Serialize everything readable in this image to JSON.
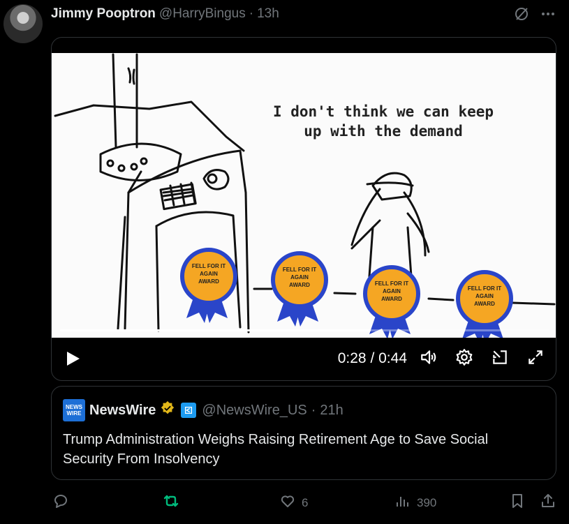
{
  "tweet": {
    "author_name": "Jimmy Pooptron",
    "author_handle": "@HarryBingus",
    "separator": "·",
    "time": "13h"
  },
  "media": {
    "caption_line1": "I don't think we can keep",
    "caption_line2": "up with the demand",
    "award_text": [
      "FELL FOR IT",
      "AGAIN",
      "AWARD"
    ],
    "current_time": "0:28",
    "time_sep": "/",
    "duration": "0:44",
    "progress": 0.636
  },
  "quote": {
    "logo_line1": "NEWS",
    "logo_line2": "WIRE",
    "name": "NewsWire",
    "handle": "@NewsWire_US",
    "separator": "·",
    "time": "21h",
    "text": "Trump Administration Weighs Raising Retirement Age to Save Social Security From Insolvency"
  },
  "actions": {
    "likes": "6",
    "views": "390"
  },
  "colors": {
    "retweet_active": "#00ba7c",
    "muted": "#71767b",
    "award_gold": "#f5a623",
    "ribbon_blue": "#2a45c9"
  }
}
